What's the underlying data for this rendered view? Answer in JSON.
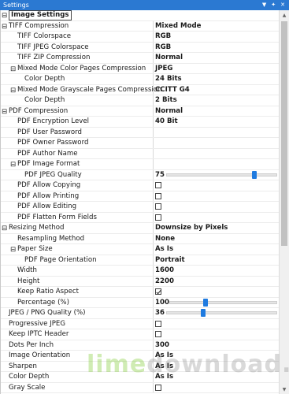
{
  "window": {
    "title": "Settings"
  },
  "titlebar_icons": [
    "chevron-down-icon",
    "pin-icon",
    "close-icon"
  ],
  "colors": {
    "accent": "#2b79d2",
    "slider": "#1f7be0"
  },
  "rows": [
    {
      "label": "Image Settings",
      "value": "",
      "indent": 0,
      "expander": "minus",
      "header": true
    },
    {
      "label": "TIFF Compression",
      "value": "Mixed Mode",
      "indent": 0,
      "expander": "minus"
    },
    {
      "label": "TIFF Colorspace",
      "value": "RGB",
      "indent": 1
    },
    {
      "label": "TIFF JPEG Colorspace",
      "value": "RGB",
      "indent": 1
    },
    {
      "label": "TIFF ZIP Compression",
      "value": "Normal",
      "indent": 1
    },
    {
      "label": "Mixed Mode Color Pages Compression",
      "value": "JPEG",
      "indent": 1,
      "expander": "minus"
    },
    {
      "label": "Color Depth",
      "value": "24 Bits",
      "indent": 2
    },
    {
      "label": "Mixed Mode Grayscale Pages Compression",
      "value": "CCITT G4",
      "indent": 1,
      "expander": "minus"
    },
    {
      "label": "Color Depth",
      "value": "2 Bits",
      "indent": 2
    },
    {
      "label": "PDF Compression",
      "value": "Normal",
      "indent": 0,
      "expander": "minus"
    },
    {
      "label": "PDF Encryption Level",
      "value": "40 Bit",
      "indent": 1
    },
    {
      "label": "PDF User Password",
      "value": "",
      "indent": 1
    },
    {
      "label": "PDF Owner Password",
      "value": "",
      "indent": 1
    },
    {
      "label": "PDF Author Name",
      "value": "",
      "indent": 1
    },
    {
      "label": "PDF Image Format",
      "value": "",
      "indent": 1,
      "expander": "minus"
    },
    {
      "label": "PDF JPEG Quality",
      "value": "75",
      "indent": 2,
      "slider": 0.8
    },
    {
      "label": "PDF Allow Copying",
      "value": "",
      "indent": 1,
      "check": false
    },
    {
      "label": "PDF Allow Printing",
      "value": "",
      "indent": 1,
      "check": false
    },
    {
      "label": "PDF Allow Editing",
      "value": "",
      "indent": 1,
      "check": false
    },
    {
      "label": "PDF Flatten Form Fields",
      "value": "",
      "indent": 1,
      "check": false
    },
    {
      "label": "Resizing Method",
      "value": "Downsize by Pixels",
      "indent": 0,
      "expander": "minus"
    },
    {
      "label": "Resampling Method",
      "value": "None",
      "indent": 1
    },
    {
      "label": "Paper Size",
      "value": "As Is",
      "indent": 1,
      "expander": "minus"
    },
    {
      "label": "PDF Page Orientation",
      "value": "Portrait",
      "indent": 2
    },
    {
      "label": "Width",
      "value": "1600",
      "indent": 1
    },
    {
      "label": "Height",
      "value": "2200",
      "indent": 1
    },
    {
      "label": "Keep Ratio Aspect",
      "value": "",
      "indent": 1,
      "check": true
    },
    {
      "label": "Percentage (%)",
      "value": "100",
      "indent": 1,
      "slider": 0.33
    },
    {
      "label": "JPEG / PNG Quality (%)",
      "value": "36",
      "indent": 0,
      "slider": 0.33
    },
    {
      "label": "Progressive JPEG",
      "value": "",
      "indent": 0,
      "check": false
    },
    {
      "label": "Keep IPTC Header",
      "value": "",
      "indent": 0,
      "check": false
    },
    {
      "label": "Dots Per Inch",
      "value": "300",
      "indent": 0
    },
    {
      "label": "Image Orientation",
      "value": "As Is",
      "indent": 0
    },
    {
      "label": "Sharpen",
      "value": "As Is",
      "indent": 0
    },
    {
      "label": "Color Depth",
      "value": "As Is",
      "indent": 0
    },
    {
      "label": "Gray Scale",
      "value": "",
      "indent": 0,
      "check": false
    }
  ],
  "watermark": {
    "part1": "lime",
    "part2": "download.com"
  }
}
